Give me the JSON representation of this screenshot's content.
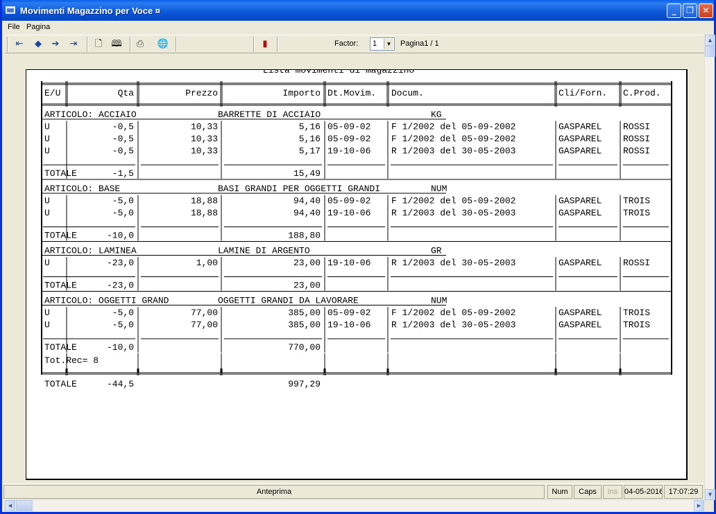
{
  "window": {
    "title": "Movimenti Magazzino per Voce ¤"
  },
  "menu": {
    "file": "File",
    "pagina": "Pagina"
  },
  "toolbar": {
    "factor_label": "Factor:",
    "factor_value": "1",
    "page_info": "Pagina1 / 1",
    "icons": [
      "first-page-icon",
      "prev-page-icon",
      "next-page-icon",
      "last-page-icon",
      "single-page-icon",
      "two-pages-icon",
      "print-icon",
      "export-icon",
      "exit-door-icon"
    ]
  },
  "report": {
    "title": "Lista movimenti di magazzino",
    "headers": {
      "eu": "E/U",
      "qta": "Qta",
      "prezzo": "Prezzo",
      "importo": "Importo",
      "dt": "Dt.Movim.",
      "docum": "Docum.",
      "cli": "Cli/Forn.",
      "cprod": "C.Prod."
    },
    "groups": [
      {
        "articolo": "ARTICOLO: ACCIAIO",
        "descr": "BARRETTE DI ACCIAIO",
        "unit": "KG",
        "rows": [
          {
            "eu": "U",
            "qta": "-0,5",
            "prezzo": "10,33",
            "importo": "5,16",
            "dt": "05-09-02",
            "docum": "F 1/2002  del 05-09-2002",
            "cli": "GASPAREL",
            "cprod": "ROSSI"
          },
          {
            "eu": "U",
            "qta": "-0,5",
            "prezzo": "10,33",
            "importo": "5,16",
            "dt": "05-09-02",
            "docum": "F 1/2002  del 05-09-2002",
            "cli": "GASPAREL",
            "cprod": "ROSSI"
          },
          {
            "eu": "U",
            "qta": "-0,5",
            "prezzo": "10,33",
            "importo": "5,17",
            "dt": "19-10-06",
            "docum": "R 1/2003  del 30-05-2003",
            "cli": "GASPAREL",
            "cprod": "ROSSI"
          }
        ],
        "total_label": "TOTALE",
        "total_qta": "-1,5",
        "total_importo": "15,49"
      },
      {
        "articolo": "ARTICOLO: BASE",
        "descr": "BASI GRANDI PER OGGETTI GRANDI",
        "unit": "NUM",
        "rows": [
          {
            "eu": "U",
            "qta": "-5,0",
            "prezzo": "18,88",
            "importo": "94,40",
            "dt": "05-09-02",
            "docum": "F 1/2002  del 05-09-2002",
            "cli": "GASPAREL",
            "cprod": "TROIS"
          },
          {
            "eu": "U",
            "qta": "-5,0",
            "prezzo": "18,88",
            "importo": "94,40",
            "dt": "19-10-06",
            "docum": "R 1/2003  del 30-05-2003",
            "cli": "GASPAREL",
            "cprod": "TROIS"
          }
        ],
        "total_label": "TOTALE",
        "total_qta": "-10,0",
        "total_importo": "188,80"
      },
      {
        "articolo": "ARTICOLO: LAMINEA",
        "descr": "LAMINE DI ARGENTO",
        "unit": "GR",
        "rows": [
          {
            "eu": "U",
            "qta": "-23,0",
            "prezzo": "1,00",
            "importo": "23,00",
            "dt": "19-10-06",
            "docum": "R 1/2003  del 30-05-2003",
            "cli": "GASPAREL",
            "cprod": "ROSSI"
          }
        ],
        "total_label": "TOTALE",
        "total_qta": "-23,0",
        "total_importo": "23,00"
      },
      {
        "articolo": "ARTICOLO: OGGETTI GRAND",
        "descr": "OGGETTI GRANDI DA LAVORARE",
        "unit": "NUM",
        "rows": [
          {
            "eu": "U",
            "qta": "-5,0",
            "prezzo": "77,00",
            "importo": "385,00",
            "dt": "05-09-02",
            "docum": "F 1/2002  del 05-09-2002",
            "cli": "GASPAREL",
            "cprod": "TROIS"
          },
          {
            "eu": "U",
            "qta": "-5,0",
            "prezzo": "77,00",
            "importo": "385,00",
            "dt": "19-10-06",
            "docum": "R 1/2003  del 30-05-2003",
            "cli": "GASPAREL",
            "cprod": "TROIS"
          }
        ],
        "total_label": "TOTALE",
        "total_qta": "-10,0",
        "total_importo": "770,00"
      }
    ],
    "tot_rec": "Tot.Rec= 8",
    "grand_total_label": "TOTALE",
    "grand_total_qta": "-44,5",
    "grand_total_importo": "997,29"
  },
  "status": {
    "message": "Anteprima",
    "num": "Num",
    "caps": "Caps",
    "ins": "Ins",
    "date": "04-05-2016",
    "time": "17:07:29"
  }
}
